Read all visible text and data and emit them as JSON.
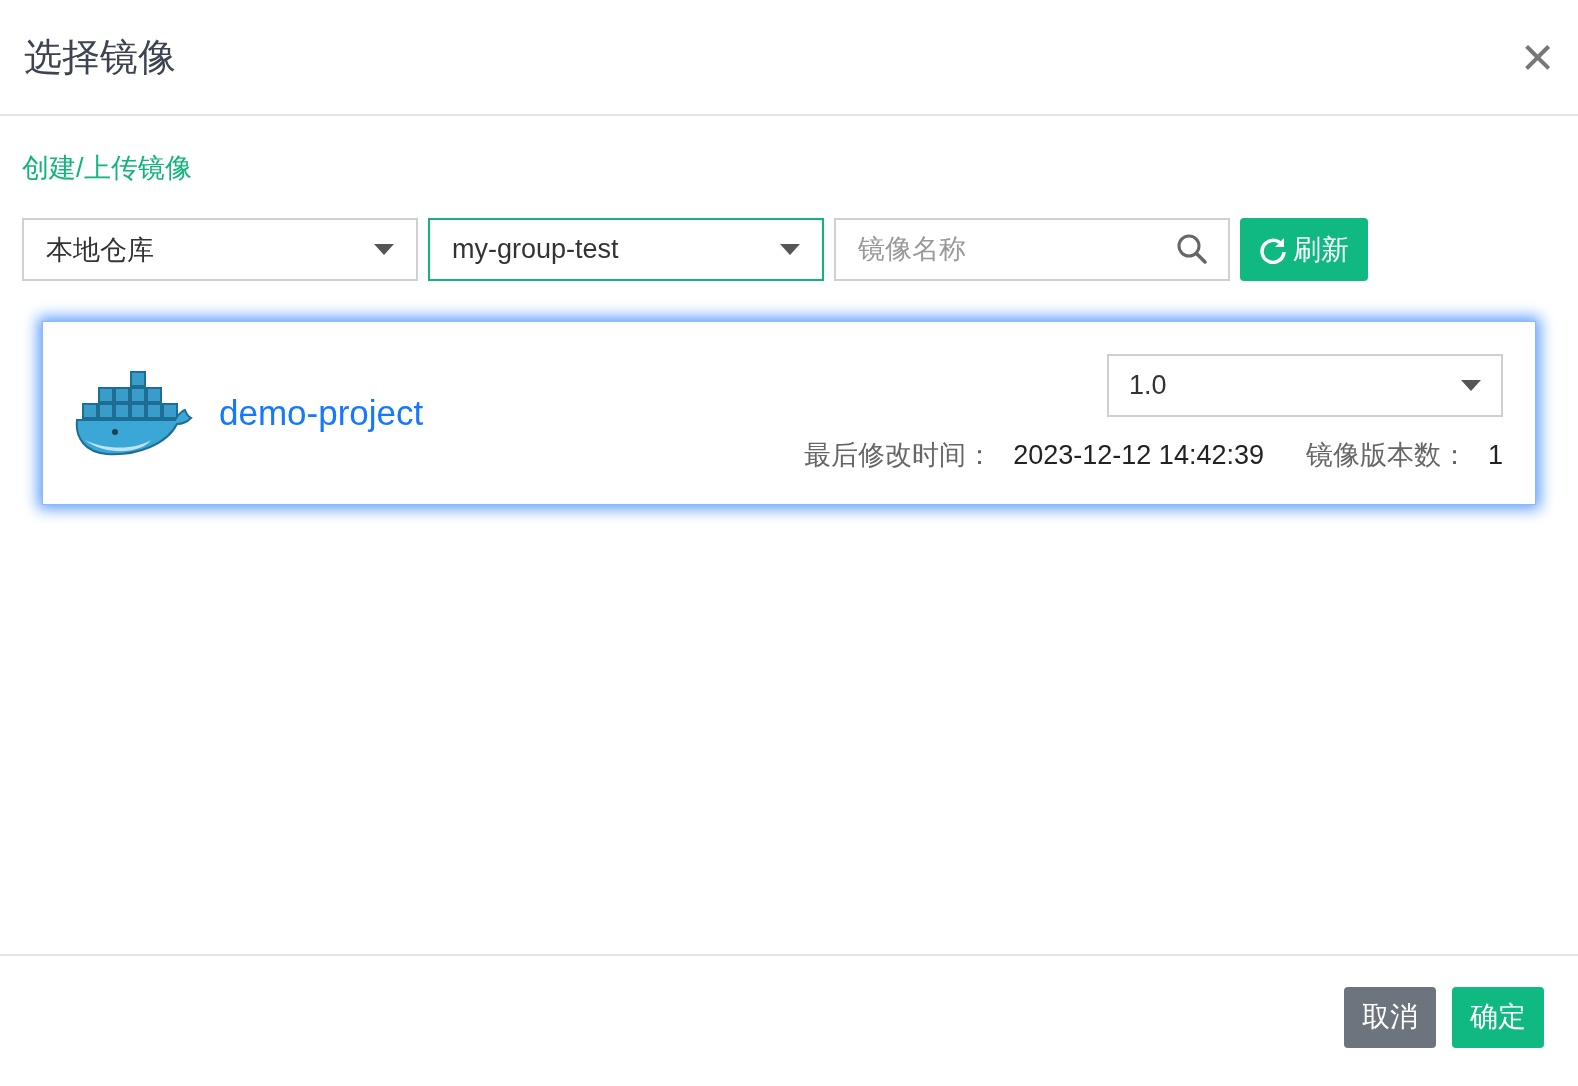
{
  "dialog": {
    "title": "选择镜像",
    "close": "×"
  },
  "create_link": "创建/上传镜像",
  "filters": [
    {
      "kind": "select",
      "value": "本地仓库",
      "focused": false
    },
    {
      "kind": "select",
      "value": "my-group-test",
      "focused": true
    },
    {
      "kind": "search",
      "placeholder": "镜像名称",
      "focused": false
    }
  ],
  "refresh_button": "刷新",
  "images": [
    {
      "name": "demo-project",
      "selected": true,
      "version": "1.0",
      "modified_label": "最后修改时间：",
      "modified_value": "2023-12-12 14:42:39",
      "count_label": "镜像版本数：",
      "count_value": "1"
    }
  ],
  "buttons": [
    {
      "label": "取消",
      "kind": "secondary"
    },
    {
      "label": "确定",
      "kind": "primary"
    }
  ]
}
